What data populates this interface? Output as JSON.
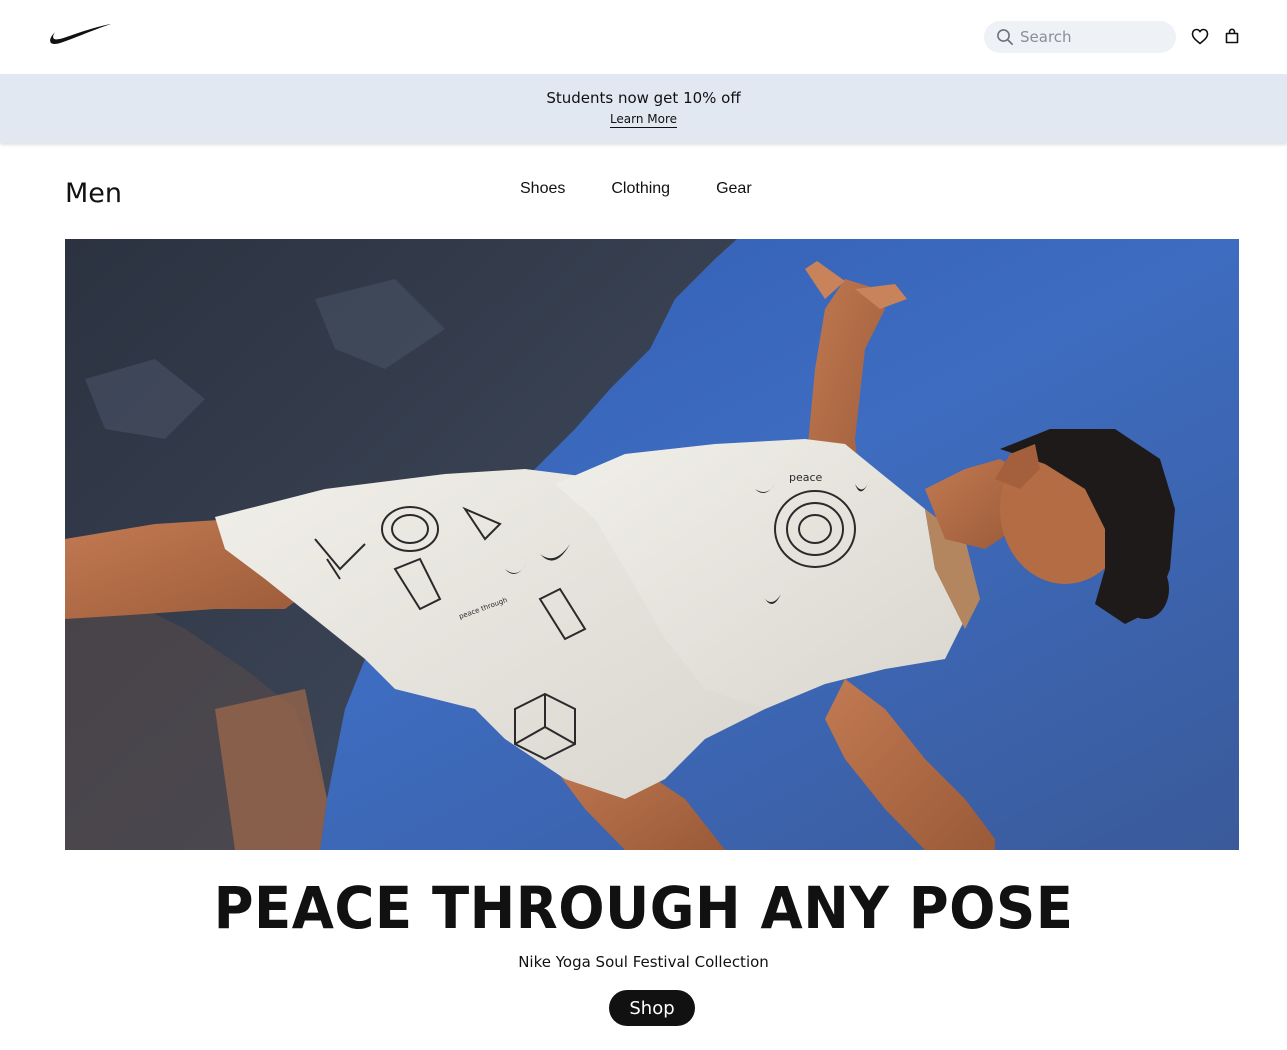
{
  "header": {
    "logo": "nike-swoosh-logo",
    "search": {
      "placeholder": "Search",
      "value": ""
    },
    "icons": [
      "search-icon",
      "heart-icon",
      "bag-icon"
    ]
  },
  "promo": {
    "text": "Students now get 10% off",
    "link": "Learn More",
    "background": "#e2e8f1"
  },
  "section": {
    "title": "Men",
    "nav": [
      "Shoes",
      "Clothing",
      "Gear"
    ]
  },
  "hero": {
    "image": "man-in-yoga-pose-white-printed-outfit-against-blue-sky-and-cliff",
    "headline": "PEACE THROUGH ANY POSE",
    "subheadline": "Nike Yoga Soul Festival Collection",
    "cta": "Shop"
  },
  "colors": {
    "brand": "#111111",
    "sky": "#3a67b9"
  }
}
